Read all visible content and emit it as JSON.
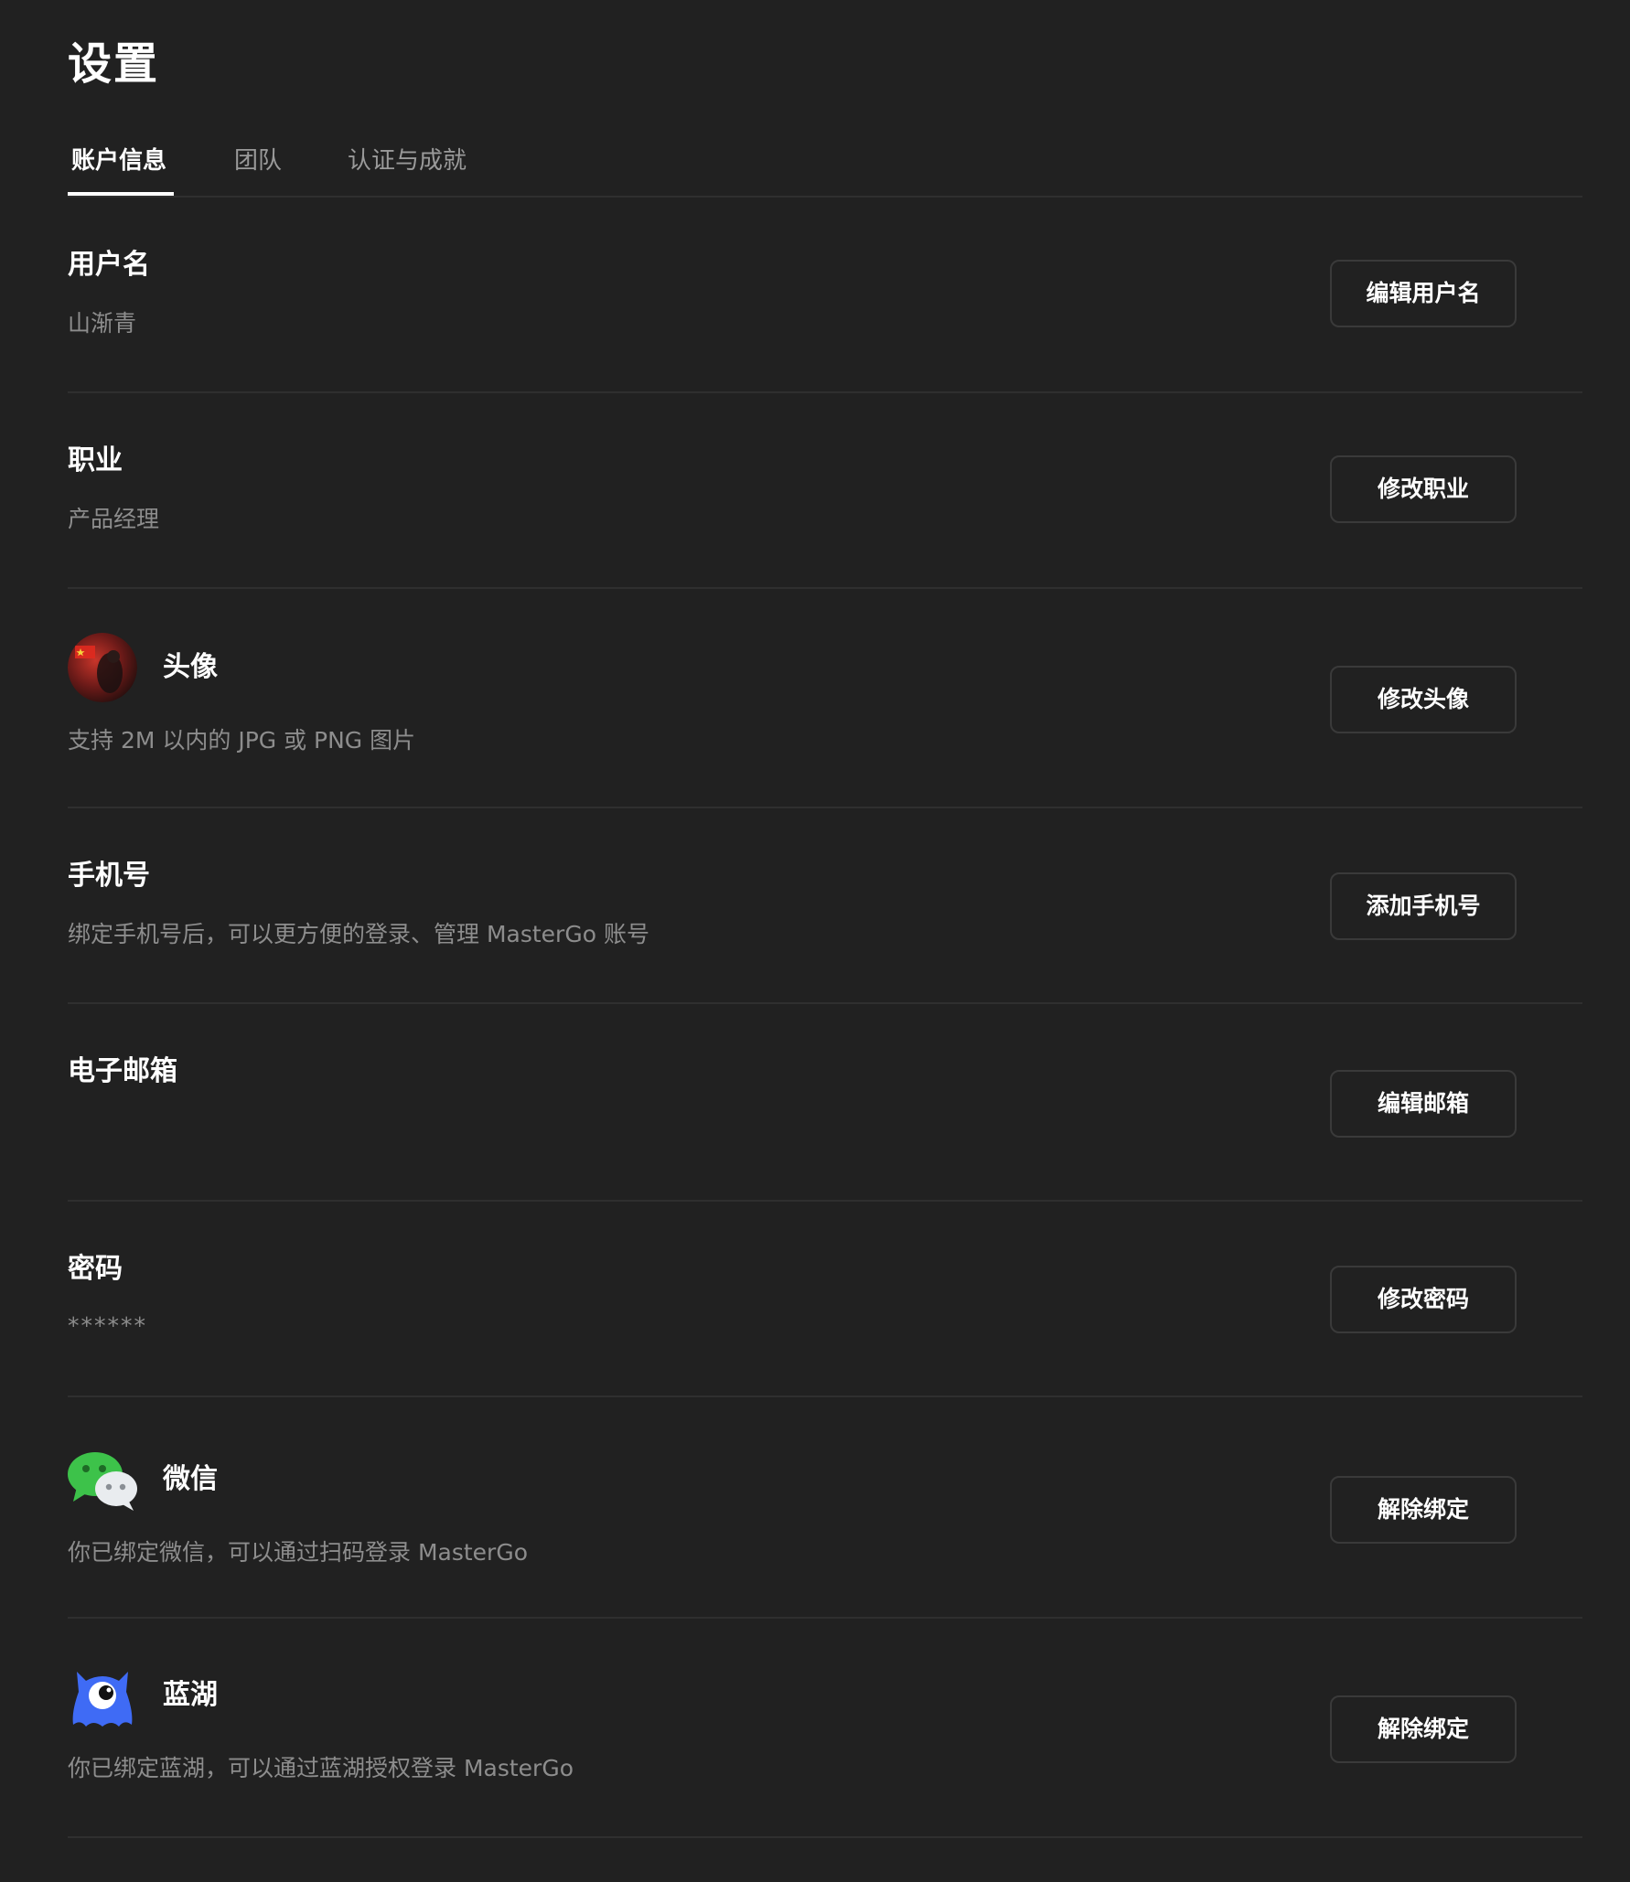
{
  "page": {
    "title": "设置"
  },
  "tabs": [
    {
      "label": "账户信息",
      "active": true
    },
    {
      "label": "团队",
      "active": false
    },
    {
      "label": "认证与成就",
      "active": false
    }
  ],
  "rows": {
    "username": {
      "title": "用户名",
      "value": "山渐青",
      "button": "编辑用户名"
    },
    "job": {
      "title": "职业",
      "value": "产品经理",
      "button": "修改职业"
    },
    "avatar": {
      "title": "头像",
      "value": "支持 2M 以内的 JPG 或 PNG 图片",
      "button": "修改头像"
    },
    "phone": {
      "title": "手机号",
      "value": "绑定手机号后，可以更方便的登录、管理 MasterGo 账号",
      "button": "添加手机号"
    },
    "email": {
      "title": "电子邮箱",
      "value": "",
      "button": "编辑邮箱"
    },
    "password": {
      "title": "密码",
      "value": "******",
      "button": "修改密码"
    },
    "wechat": {
      "title": "微信",
      "value": "你已绑定微信，可以通过扫码登录 MasterGo",
      "button": "解除绑定"
    },
    "lanhu": {
      "title": "蓝湖",
      "value": "你已绑定蓝湖，可以通过蓝湖授权登录 MasterGo",
      "button": "解除绑定"
    }
  },
  "colors": {
    "background": "#212121",
    "divider": "#2f2f2f",
    "text_primary": "#ffffff",
    "text_secondary": "#8d8d8d",
    "wechat_green": "#3dc24a",
    "lanhu_blue": "#3f6bf5"
  },
  "icons": {
    "avatar": "user-avatar-photo",
    "wechat": "wechat-icon",
    "lanhu": "lanhu-icon"
  }
}
